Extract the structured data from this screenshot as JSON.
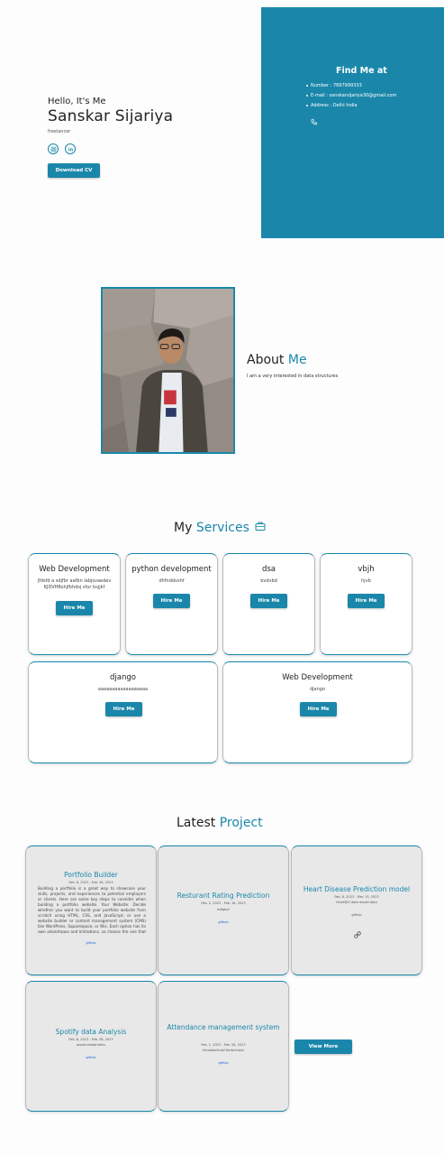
{
  "hero": {
    "greeting": "Hello, It's Me",
    "name": "Sanskar Sijariya",
    "role": "freelancer",
    "download_label": "Download CV",
    "social_icons": [
      "instagram-icon",
      "linkedin-icon"
    ]
  },
  "find_me": {
    "title": "Find Me at",
    "number": "Number : 7697999333",
    "email": "E-mail : sanskarsijariya30@gmail.com",
    "address": "Address : Delhi India",
    "phone_icon": "phone-icon"
  },
  "about": {
    "title_plain": "About",
    "title_accent": "Me",
    "text": "I am a very interested in data structures"
  },
  "services": {
    "title_plain": "My",
    "title_accent": "Services",
    "title_icon": "briefcase-icon",
    "hire_label": "Hire Me",
    "cards": [
      {
        "title": "Web Development",
        "desc": "jfdsfd a sdjfbr aafbn labjsvaedev KJDVHBshjfbhdsj sfur bsjjkf"
      },
      {
        "title": "python development",
        "desc": "dhfnddvshf"
      },
      {
        "title": "dsa",
        "desc": "bvdvbd"
      },
      {
        "title": "vbjh",
        "desc": "hjvb"
      },
      {
        "title": "django",
        "desc": "aaaaaaaaaaaaaaaaaa"
      },
      {
        "title": "Web Development",
        "desc": "django"
      }
    ]
  },
  "projects": {
    "title_plain": "Latest",
    "title_accent": "Project",
    "view_more_label": "View More",
    "cards": [
      {
        "title": "Portfolio Builder",
        "date": "Feb. 8, 2023 - Feb. 26, 2023",
        "desc": "Building a portfolio is a great way to showcase your skills, projects, and experiences to potential employers or clients. Here are some key steps to consider when building a portfolio website. Your Website: Decide whether you want to build your portfolio website from scratch using HTML, CSS, and JavaScript, or use a website builder or content management system (CMS) like WordPress, Squarespace, or Wix. Each option has its own advantages and limitations, so choose the one that suits you best.",
        "link": "github"
      },
      {
        "title": "Resturant Rating Prediction",
        "date": "Feb. 2, 2023 - Feb. 18, 2023",
        "small": "bdfgbvf",
        "link": "github"
      },
      {
        "title": "Heart Disease Prediction model",
        "date": "Feb. 8, 2023 - Mar. 15, 2023",
        "small": "heart@rf data model data",
        "link": "github",
        "link_icon": "link-icon"
      },
      {
        "title": "Spotify data Analysis",
        "date": "Feb. 8, 2023 - Feb. 28, 2023",
        "small": "anashuvhdahdhhs",
        "link": "github"
      },
      {
        "title": "Attendance management system",
        "date": "Feb. 1, 2023 - Feb. 26, 2023",
        "small": "fnhvbdsfvhdsf bhdsfvhdsv",
        "link": "github"
      }
    ]
  },
  "colors": {
    "accent": "#1a87aa",
    "card_bg": "#e8e8e8"
  }
}
